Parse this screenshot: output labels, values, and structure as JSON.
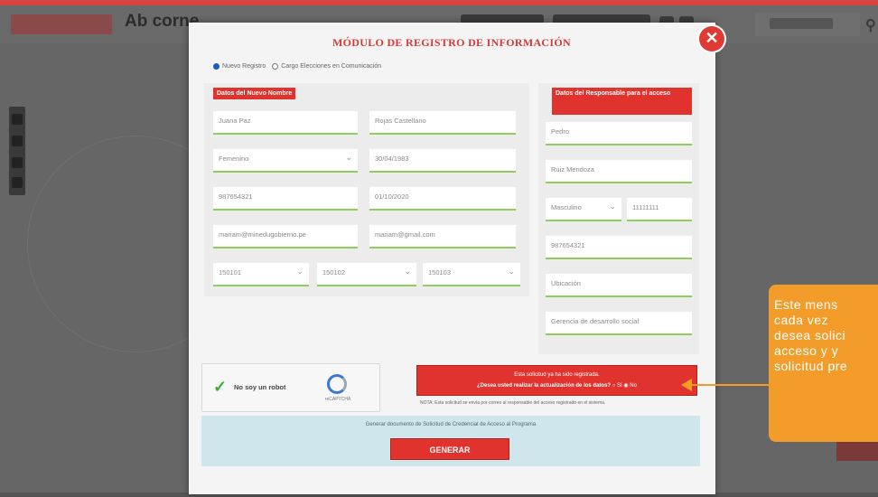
{
  "background": {
    "brand_text": "Ab corne"
  },
  "modal": {
    "title": "MÓDULO DE REGISTRO DE INFORMACIÓN",
    "close_label": "✕",
    "radio_options": [
      "Nuevo Registro",
      "Cargo Elecciones en Comunicación"
    ],
    "left_section_label": "Datos del Nuevo Nombre",
    "right_section_label": "Datos del Responsable para el acceso",
    "left_fields": [
      "Juana Paz",
      "Rojas Castellano",
      "Femenino",
      "30/04/1983",
      "987654321",
      "01/10/2020",
      "mariam@minedugobierno.pe",
      "mariam@gmail.com",
      "150101",
      "150102",
      "150103"
    ],
    "right_fields": [
      "Pedro",
      "Ruiz Mendoza",
      "Masculino",
      "11111111",
      "987654321",
      "Ubicación",
      "Gerencia de desarrollo social"
    ],
    "captcha": {
      "label": "No soy un robot",
      "brand": "reCAPTCHA"
    },
    "alert": {
      "line1": "Esta solicitud ya ha sido registrada.",
      "line2": "¿Desea usted realizar la actualización de los datos?",
      "yes": "Sí",
      "no": "No"
    },
    "note": "NOTA: Esta solicitud se envía por correo al responsable del acceso registrado en el sistema.",
    "generate_text": "Generar documento de Solicitud de Credencial de Acceso al Programa",
    "generate_button": "GENERAR"
  },
  "callout": {
    "lines": [
      "Este mens",
      "cada vez",
      "desea solici",
      "acceso y y",
      "solicitud pre"
    ]
  }
}
